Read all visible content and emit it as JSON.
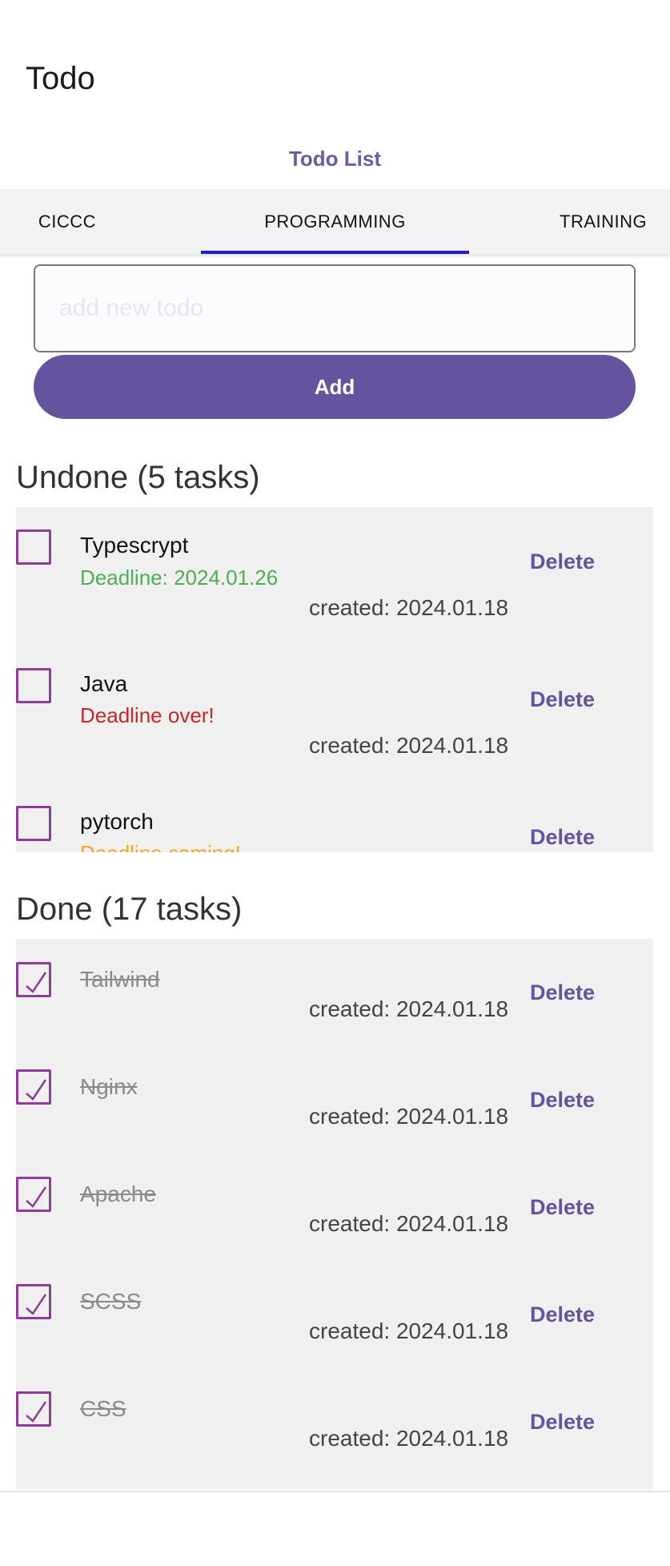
{
  "app": {
    "title": "Todo"
  },
  "header": {
    "title": "Todo List"
  },
  "tabs": [
    {
      "label": "CICCC"
    },
    {
      "label": "PROGRAMMING",
      "active": true
    },
    {
      "label": "TRAINING"
    }
  ],
  "form": {
    "placeholder": "add new todo",
    "value": "",
    "add_label": "Add"
  },
  "undone": {
    "title": "Undone (5 tasks)",
    "items": [
      {
        "title": "Typescrypt",
        "deadline": "Deadline: 2024.01.26",
        "deadline_color": "#4caf50",
        "created": "created: 2024.01.18",
        "delete_label": "Delete"
      },
      {
        "title": "Java",
        "deadline": "Deadline over!",
        "deadline_color": "#c62828",
        "created": "created: 2024.01.18",
        "delete_label": "Delete"
      },
      {
        "title": "pytorch",
        "deadline": "Deadline coming!",
        "deadline_color": "#f5a623",
        "created": "",
        "delete_label": "Delete"
      }
    ]
  },
  "done": {
    "title": "Done (17 tasks)",
    "items": [
      {
        "title": "Tailwind",
        "created": "created: 2024.01.18",
        "delete_label": "Delete"
      },
      {
        "title": "Nginx",
        "created": "created: 2024.01.18",
        "delete_label": "Delete"
      },
      {
        "title": "Apache",
        "created": "created: 2024.01.18",
        "delete_label": "Delete"
      },
      {
        "title": "SCSS",
        "created": "created: 2024.01.18",
        "delete_label": "Delete"
      },
      {
        "title": "CSS",
        "created": "created: 2024.01.18",
        "delete_label": "Delete"
      }
    ]
  },
  "colors": {
    "accent": "#6553a0",
    "checkbox": "#8e3c96",
    "tab_indicator": "#1c1ccf",
    "panel_bg": "#f0f0f0"
  },
  "icons": {
    "checked": "check-icon"
  }
}
